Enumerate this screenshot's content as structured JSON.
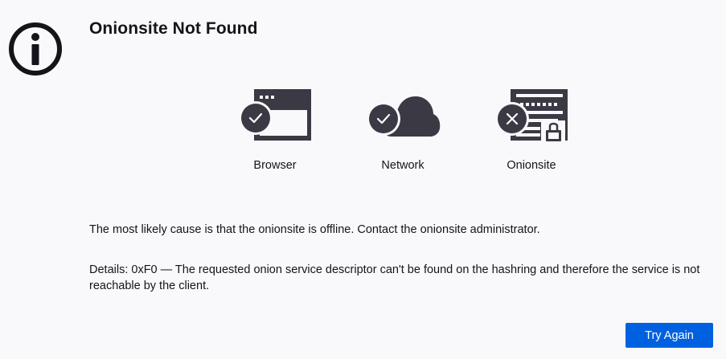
{
  "page": {
    "title": "Onionsite Not Found"
  },
  "diagram": {
    "items": [
      {
        "label": "Browser",
        "status": "ok",
        "icon": "browser-window-icon"
      },
      {
        "label": "Network",
        "status": "ok",
        "icon": "cloud-icon"
      },
      {
        "label": "Onionsite",
        "status": "error",
        "icon": "onion-server-icon"
      }
    ]
  },
  "message": {
    "cause": "The most likely cause is that the onionsite is offline. Contact the onionsite administrator.",
    "details": "Details: 0xF0 — The requested onion service descriptor can't be found on the hashring and therefore the service is not reachable by the client."
  },
  "actions": {
    "try_again_label": "Try Again"
  },
  "colors": {
    "background": "#f9f9fb",
    "icon_dark": "#3a3944",
    "primary_button": "#0061e0",
    "text": "#15141a"
  }
}
